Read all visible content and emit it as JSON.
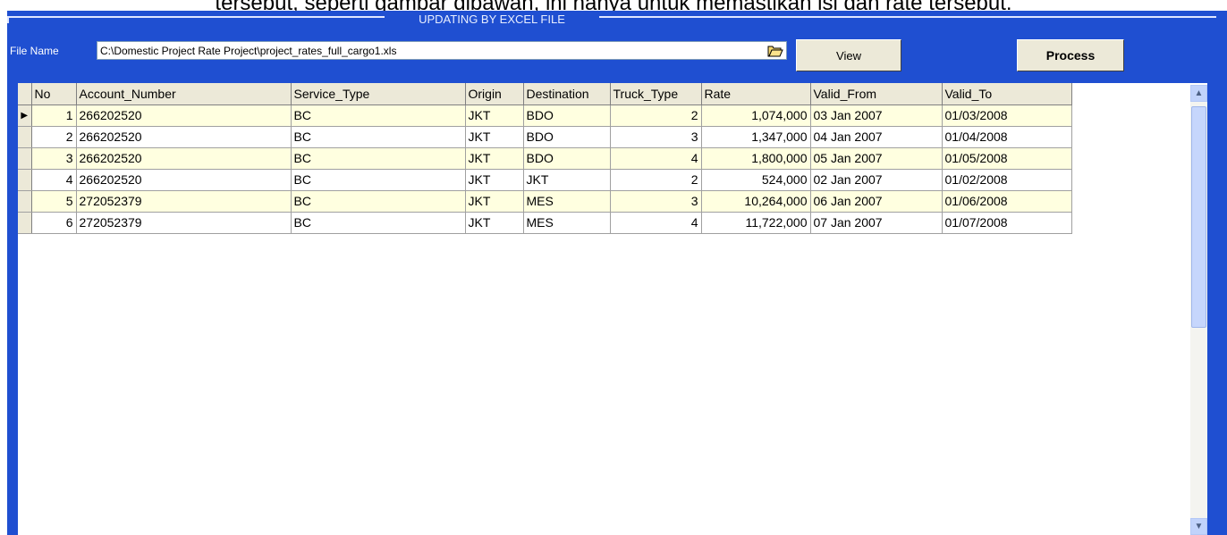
{
  "caption": "tersebut, seperti gambar dibawah, ini hanya untuk memastikan isi dan rate tersebut.",
  "window": {
    "title": "UPDATING BY EXCEL FILE"
  },
  "file": {
    "label": "File Name",
    "path": "C:\\Domestic Project Rate Project\\project_rates_full_cargo1.xls",
    "open_icon": "folder-open-icon"
  },
  "buttons": {
    "view": "View",
    "process": "Process"
  },
  "grid": {
    "columns": [
      "No",
      "Account_Number",
      "Service_Type",
      "Origin",
      "Destination",
      "Truck_Type",
      "Rate",
      "Valid_From",
      "Valid_To"
    ],
    "current_row_icon": "row-pointer-icon",
    "rows": [
      [
        "1",
        "266202520",
        "BC",
        "JKT",
        "BDO",
        "2",
        "1,074,000",
        "03 Jan 2007",
        "01/03/2008"
      ],
      [
        "2",
        "266202520",
        "BC",
        "JKT",
        "BDO",
        "3",
        "1,347,000",
        "04 Jan 2007",
        "01/04/2008"
      ],
      [
        "3",
        "266202520",
        "BC",
        "JKT",
        "BDO",
        "4",
        "1,800,000",
        "05 Jan 2007",
        "01/05/2008"
      ],
      [
        "4",
        "266202520",
        "BC",
        "JKT",
        "JKT",
        "2",
        "524,000",
        "02 Jan 2007",
        "01/02/2008"
      ],
      [
        "5",
        "272052379",
        "BC",
        "JKT",
        "MES",
        "3",
        "10,264,000",
        "06 Jan 2007",
        "01/06/2008"
      ],
      [
        "6",
        "272052379",
        "BC",
        "JKT",
        "MES",
        "4",
        "11,722,000",
        "07 Jan 2007",
        "01/07/2008"
      ]
    ]
  },
  "colors": {
    "frame": "#1f4fd1",
    "alt_row": "#ffffe0"
  }
}
